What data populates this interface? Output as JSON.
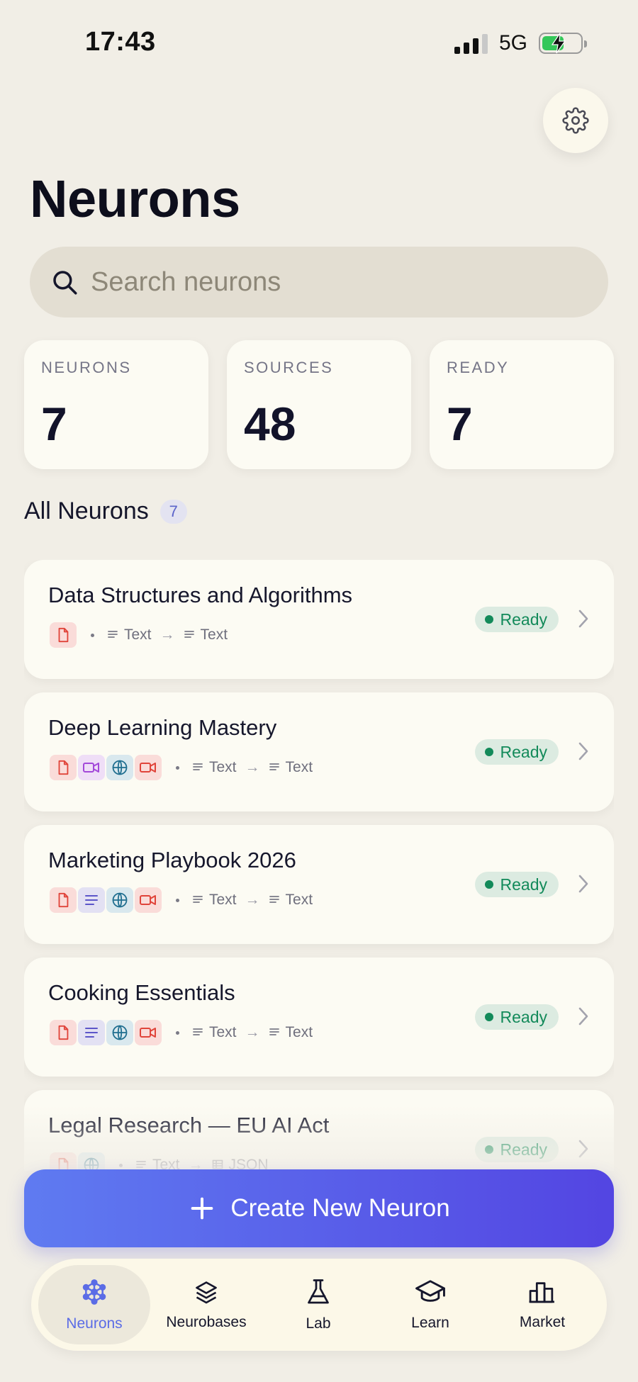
{
  "status_bar": {
    "time": "17:43",
    "network": "5G"
  },
  "page": {
    "title": "Neurons"
  },
  "search": {
    "placeholder": "Search neurons",
    "value": ""
  },
  "stats": [
    {
      "label": "NEURONS",
      "value": "7"
    },
    {
      "label": "SOURCES",
      "value": "48"
    },
    {
      "label": "READY",
      "value": "7"
    }
  ],
  "section": {
    "title": "All Neurons",
    "count": "7"
  },
  "neurons": [
    {
      "name": "Data Structures and Algorithms",
      "sources": [
        "pdf-icon"
      ],
      "input": "Text",
      "output": "Text",
      "status": "Ready"
    },
    {
      "name": "Deep Learning Mastery",
      "sources": [
        "pdf-icon",
        "video-icon",
        "globe-icon",
        "recording-icon"
      ],
      "input": "Text",
      "output": "Text",
      "status": "Ready"
    },
    {
      "name": "Marketing Playbook 2026",
      "sources": [
        "pdf-icon",
        "text-icon",
        "globe-icon",
        "recording-icon"
      ],
      "input": "Text",
      "output": "Text",
      "status": "Ready"
    },
    {
      "name": "Cooking Essentials",
      "sources": [
        "pdf-icon",
        "text-icon",
        "globe-icon",
        "recording-icon"
      ],
      "input": "Text",
      "output": "Text",
      "status": "Ready"
    },
    {
      "name": "Legal Research — EU AI Act",
      "sources": [
        "pdf-icon",
        "globe-icon"
      ],
      "input": "Text",
      "output": "JSON",
      "status": "Ready"
    }
  ],
  "create_button": {
    "label": "Create New Neuron"
  },
  "tabs": [
    {
      "label": "Neurons",
      "icon": "network-icon",
      "active": true
    },
    {
      "label": "Neurobases",
      "icon": "layers-icon",
      "active": false
    },
    {
      "label": "Lab",
      "icon": "flask-icon",
      "active": false
    },
    {
      "label": "Learn",
      "icon": "graduation-cap-icon",
      "active": false
    },
    {
      "label": "Market",
      "icon": "bar-chart-icon",
      "active": false
    }
  ],
  "colors": {
    "background": "#f1eee6",
    "card": "#fcfbf3",
    "accent": "#5b6ce6",
    "ready": "#138a5a",
    "button_gradient_start": "#5f7bf1",
    "button_gradient_end": "#5345e2"
  }
}
